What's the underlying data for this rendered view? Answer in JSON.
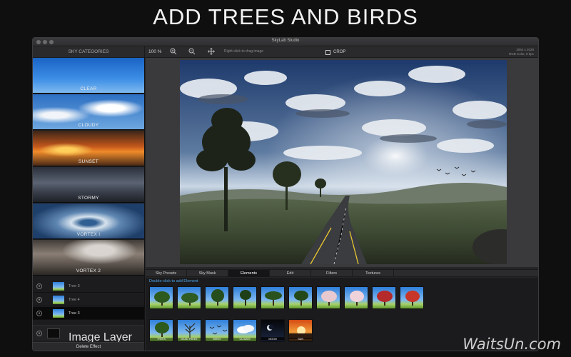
{
  "promo": {
    "title": "ADD TREES AND BIRDS"
  },
  "window": {
    "title": "SkyLab Studio"
  },
  "toolbar": {
    "sidebar_header": "SKY CATEGORIES",
    "zoom": "100 %",
    "hint": "Right-click to drag image",
    "crop_label": "CROP",
    "image_size": "3064 x 2028",
    "image_mode": "RGB Color, 8 bpc"
  },
  "categories": [
    {
      "label": "CLEAR"
    },
    {
      "label": "CLOUDY"
    },
    {
      "label": "SUNSET"
    },
    {
      "label": "STORMY"
    },
    {
      "label": "VORTEX I"
    },
    {
      "label": "VORTEX 2"
    }
  ],
  "tabs": [
    {
      "label": "Sky Presets"
    },
    {
      "label": "Sky Mask"
    },
    {
      "label": "Elements",
      "active": true
    },
    {
      "label": "Edit"
    },
    {
      "label": "Filters"
    },
    {
      "label": "Textures"
    }
  ],
  "elements_panel": {
    "hint": "Double-click to add Element",
    "row1": [
      {
        "icon": "tree-icon",
        "caption": ""
      },
      {
        "icon": "tree-icon",
        "caption": ""
      },
      {
        "icon": "tree-icon",
        "caption": ""
      },
      {
        "icon": "tree-icon",
        "caption": ""
      },
      {
        "icon": "tree-icon",
        "caption": ""
      },
      {
        "icon": "tree-icon",
        "caption": ""
      },
      {
        "icon": "blossom-tree-icon",
        "caption": ""
      },
      {
        "icon": "blossom-tree-icon",
        "caption": ""
      },
      {
        "icon": "red-tree-icon",
        "caption": ""
      },
      {
        "icon": "red-tree-icon",
        "caption": ""
      }
    ],
    "row2": [
      {
        "icon": "tree-icon",
        "caption": "TREES"
      },
      {
        "icon": "dead-tree-icon",
        "caption": "DEAD TREES"
      },
      {
        "icon": "birds-icon",
        "caption": "BIRDS"
      },
      {
        "icon": "cloud-icon",
        "caption": "CLOUDS"
      },
      {
        "icon": "moon-icon",
        "caption": "MOON"
      },
      {
        "icon": "sun-icon",
        "caption": "SUN"
      }
    ]
  },
  "layers": [
    {
      "name": "Tree 3"
    },
    {
      "name": "Tree 4"
    },
    {
      "name": "Tree 3",
      "active": true
    }
  ],
  "image_layer": {
    "label": "Image Layer"
  },
  "delete_effect": {
    "label": "Delete Effect"
  },
  "watermark": {
    "text": "WaitsUn.com"
  },
  "colors": {
    "accent_blue": "#4ba3e8",
    "window_bg": "#262628",
    "page_bg": "#0f0f10"
  }
}
